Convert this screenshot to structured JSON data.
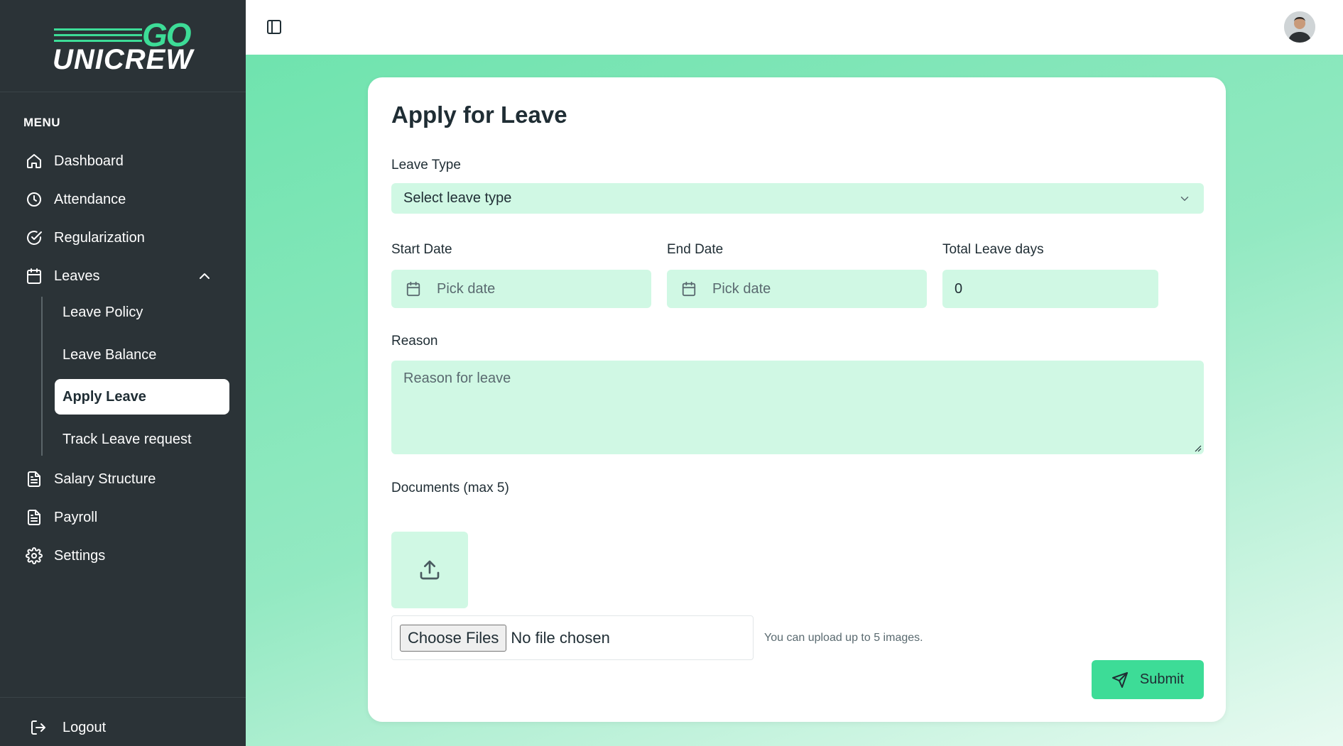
{
  "brand": {
    "go": "GO",
    "name": "UNICREW",
    "accent": "#3ddc97",
    "sidebar_bg": "#2b3337"
  },
  "sidebar": {
    "menu_title": "MENU",
    "items": [
      {
        "label": "Dashboard",
        "icon": "home-icon"
      },
      {
        "label": "Attendance",
        "icon": "clock-icon"
      },
      {
        "label": "Regularization",
        "icon": "check-circle-icon"
      },
      {
        "label": "Leaves",
        "icon": "calendar-icon"
      },
      {
        "label": "Salary Structure",
        "icon": "document-icon"
      },
      {
        "label": "Payroll",
        "icon": "document-icon"
      },
      {
        "label": "Settings",
        "icon": "gear-icon"
      }
    ],
    "leaves_sub": [
      {
        "label": "Leave Policy"
      },
      {
        "label": "Leave Balance"
      },
      {
        "label": "Apply Leave",
        "active": true
      },
      {
        "label": "Track Leave request"
      }
    ],
    "logout": "Logout"
  },
  "form": {
    "title": "Apply for Leave",
    "leave_type": {
      "label": "Leave Type",
      "placeholder": "Select leave type"
    },
    "start_date": {
      "label": "Start Date",
      "placeholder": "Pick date"
    },
    "end_date": {
      "label": "End Date",
      "placeholder": "Pick date"
    },
    "total_days": {
      "label": "Total Leave days",
      "value": "0"
    },
    "reason": {
      "label": "Reason",
      "placeholder": "Reason for leave"
    },
    "documents": {
      "label": "Documents (max 5)",
      "choose_button": "Choose Files",
      "file_status": "No file chosen",
      "hint": "You can upload up to 5 images."
    },
    "submit_label": "Submit"
  }
}
